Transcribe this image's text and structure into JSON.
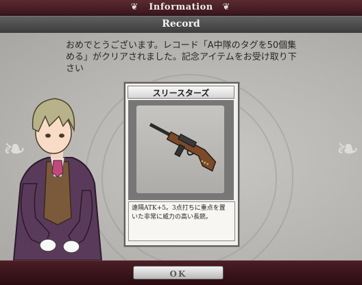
{
  "header": {
    "title": "Information",
    "left_ornament": "fleur-icon",
    "right_ornament": "fleur-icon"
  },
  "record_bar": {
    "title": "Record"
  },
  "message": "おめでとうございます。レコード「A中隊のタグを50個集める」がクリアされました。記念アイテムをお受け取り下さい",
  "item": {
    "name": "スリースターズ",
    "icon": "rifle-icon",
    "description": "遠隔ATK+5。3点打ちに重点を置いた非常に威力の高い長銃。"
  },
  "footer": {
    "ok_label": "OK"
  },
  "colors": {
    "header_bg": "#4a1e26",
    "panel_bg": "#b8b6b2",
    "record_bar_bg": "#505050"
  }
}
